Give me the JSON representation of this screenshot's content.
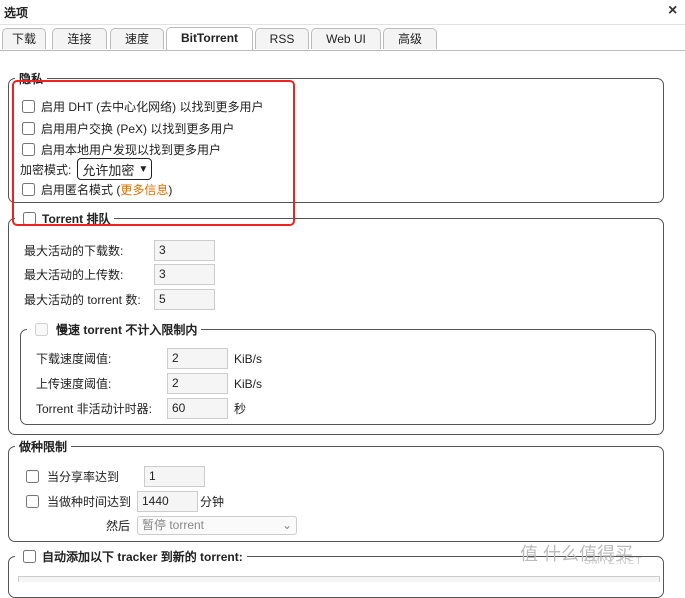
{
  "window": {
    "title": "选项",
    "close": "×"
  },
  "tabs": [
    "下载",
    "连接",
    "速度",
    "BitTorrent",
    "RSS",
    "Web UI",
    "高级"
  ],
  "privacy": {
    "legend": "隐私",
    "dht_label": "启用 DHT (去中心化网络) 以找到更多用户",
    "pex_label": "启用用户交换 (PeX) 以找到更多用户",
    "lsd_label": "启用本地用户发现以找到更多用户",
    "encryption_label": "加密模式:",
    "encryption_value": "允许加密",
    "anon_prefix": "启用匿名模式 (",
    "anon_link": "更多信息",
    "anon_suffix": ")"
  },
  "queue": {
    "legend": "Torrent 排队",
    "max_downloads_label": "最大活动的下载数:",
    "max_downloads": "3",
    "max_uploads_label": "最大活动的上传数:",
    "max_uploads": "3",
    "max_torrents_label": "最大活动的 torrent 数:",
    "max_torrents": "5",
    "slow": {
      "legend": "慢速 torrent 不计入限制内",
      "dl_label": "下载速度阈值:",
      "dl_value": "2",
      "ul_label": "上传速度阈值:",
      "ul_value": "2",
      "unit": "KiB/s",
      "timer_label": "Torrent 非活动计时器:",
      "timer_value": "60",
      "timer_unit": "秒"
    }
  },
  "seeding": {
    "legend": "做种限制",
    "ratio_label": "当分享率达到",
    "ratio_value": "1",
    "time_label": "当做种时间达到",
    "time_value": "1440",
    "time_unit": "分钟",
    "then_label": "然后",
    "action_value": "暂停 torrent"
  },
  "trackers": {
    "legend": "自动添加以下 tracker 到新的 torrent:"
  },
  "watermark": {
    "main": "值 什么值得买",
    "sub": "SMYZ.NET"
  }
}
